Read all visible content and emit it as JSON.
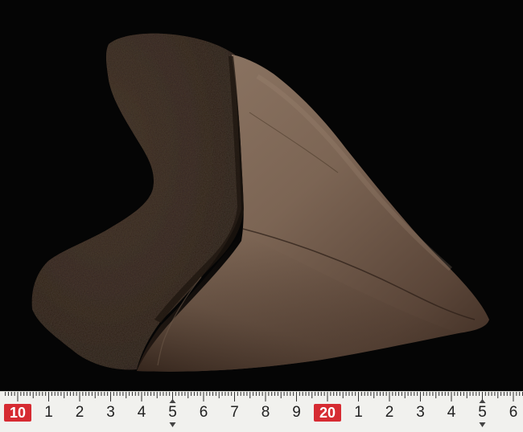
{
  "photo": {
    "subject_colors": {
      "background": "#050505",
      "root_dark": "#2a1d15",
      "root_mid": "#3b2a1f",
      "blade_light": "#8a7462",
      "blade_mid": "#6b5646",
      "blade_dark": "#3a2a20"
    }
  },
  "ruler": {
    "background_color": "#f1f1ee",
    "major_color": "#d62b32",
    "labels": [
      {
        "text": "10",
        "major": true
      },
      {
        "text": "1",
        "major": false
      },
      {
        "text": "2",
        "major": false
      },
      {
        "text": "3",
        "major": false
      },
      {
        "text": "4",
        "major": false
      },
      {
        "text": "5",
        "major": false
      },
      {
        "text": "6",
        "major": false
      },
      {
        "text": "7",
        "major": false
      },
      {
        "text": "8",
        "major": false
      },
      {
        "text": "9",
        "major": false
      },
      {
        "text": "20",
        "major": true
      },
      {
        "text": "1",
        "major": false
      },
      {
        "text": "2",
        "major": false
      },
      {
        "text": "3",
        "major": false
      },
      {
        "text": "4",
        "major": false
      },
      {
        "text": "5",
        "major": false
      },
      {
        "text": "6",
        "major": false
      }
    ]
  }
}
